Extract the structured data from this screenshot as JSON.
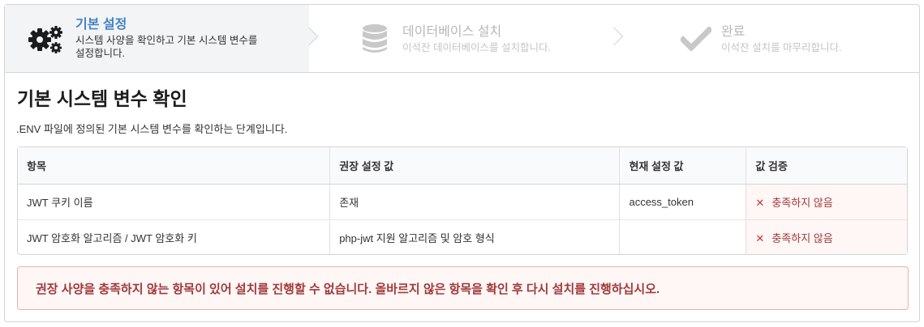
{
  "steps": [
    {
      "title": "기본 설정",
      "desc_line1": "시스템 사양을 확인하고 기본 시스템 변수를",
      "desc_line2": "설정합니다.",
      "icon": "cogs-icon",
      "state": "active"
    },
    {
      "title": "데이터베이스 설치",
      "desc_line1": "이석잔 데이터베이스를 설치합니다.",
      "icon": "database-icon",
      "state": "disabled"
    },
    {
      "title": "완료",
      "desc_line1": "이석잔 설치를 마무리합니다.",
      "icon": "check-icon",
      "state": "disabled"
    }
  ],
  "page": {
    "heading": "기본 시스템 변수 확인",
    "intro": ".ENV 파일에 정의된 기본 시스템 변수를 확인하는 단계입니다."
  },
  "table": {
    "headers": [
      "항목",
      "권장 설정 값",
      "현재 설정 값",
      "값 검증"
    ],
    "rows": [
      {
        "item": "JWT 쿠키 이름",
        "recommended": "존재",
        "current": "access_token",
        "status": "충족하지 않음"
      },
      {
        "item": "JWT 암호화 알고리즘 / JWT 암호화 키",
        "recommended": "php-jwt 지원 알고리즘 및 암호 형식",
        "current": "",
        "status": "충족하지 않음"
      }
    ]
  },
  "alert": {
    "message": "권장 사양을 충족하지 않는 항목이 있어 설치를 진행할 수 없습니다. 올바르지 않은 항목을 확인 후 다시 설치를 진행하십시오."
  },
  "colors": {
    "active_title": "#4183c4",
    "error_text": "#9f3a38",
    "error_bg": "#fff6f6",
    "error_border": "#e0b4b4",
    "disabled_text": "#c4c4c4"
  }
}
